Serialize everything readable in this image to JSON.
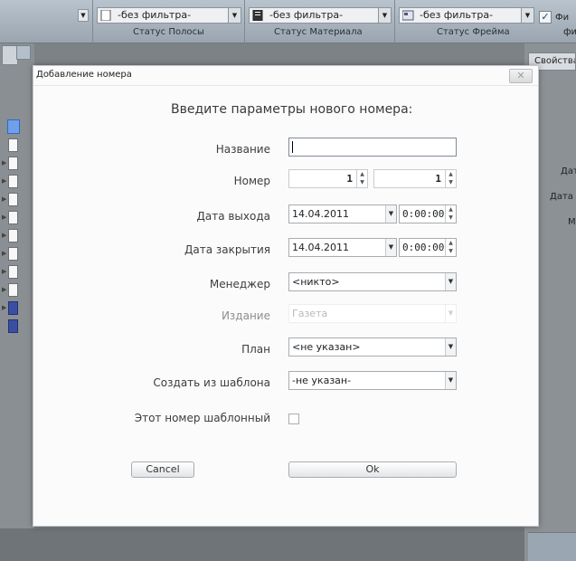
{
  "toolbar": {
    "filters": [
      {
        "value": "-без фильтра-",
        "caption": "Статус Полосы",
        "icon": "page-icon"
      },
      {
        "value": "-без фильтра-",
        "caption": "Статус Материала",
        "icon": "article-icon"
      },
      {
        "value": "-без фильтра-",
        "caption": "Статус Фрейма",
        "icon": "frame-icon"
      }
    ],
    "right_label_1": "Фи",
    "right_label_2": "фи"
  },
  "right_panel": {
    "header": "Свойства",
    "label_1": "Дат",
    "label_2": "Дата",
    "label_3": "М"
  },
  "dialog": {
    "title": "Добавление номера",
    "heading": "Введите параметры нового номера:",
    "close_label": "✕",
    "fields": {
      "name_label": "Название",
      "name_value": "",
      "number_label": "Номер",
      "number_value_1": "1",
      "number_value_2": "1",
      "release_date_label": "Дата выхода",
      "release_date_value": "14.04.2011",
      "release_time_value": "0:00:00",
      "close_date_label": "Дата закрытия",
      "close_date_value": "14.04.2011",
      "close_time_value": "0:00:00",
      "manager_label": "Менеджер",
      "manager_value": "<никто>",
      "edition_label": "Издание",
      "edition_value": "Газета",
      "plan_label": "План",
      "plan_value": "<не указан>",
      "template_label": "Создать из шаблона",
      "template_value": "-не указан-",
      "is_template_label": "Этот номер шаблонный",
      "is_template_checked": false
    },
    "buttons": {
      "cancel": "Cancel",
      "ok": "Ok"
    }
  }
}
